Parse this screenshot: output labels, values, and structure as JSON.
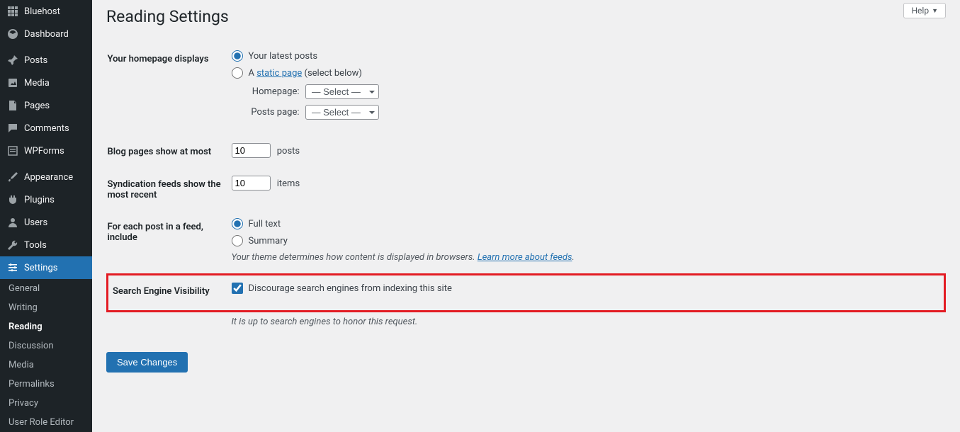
{
  "sidebar": {
    "top": [
      {
        "icon": "grid",
        "label": "Bluehost"
      },
      {
        "icon": "dashboard",
        "label": "Dashboard"
      }
    ],
    "content": [
      {
        "icon": "pin",
        "label": "Posts"
      },
      {
        "icon": "media",
        "label": "Media"
      },
      {
        "icon": "page",
        "label": "Pages"
      },
      {
        "icon": "comment",
        "label": "Comments"
      },
      {
        "icon": "form",
        "label": "WPForms"
      }
    ],
    "config": [
      {
        "icon": "brush",
        "label": "Appearance"
      },
      {
        "icon": "plug",
        "label": "Plugins"
      },
      {
        "icon": "user",
        "label": "Users"
      },
      {
        "icon": "wrench",
        "label": "Tools"
      },
      {
        "icon": "sliders",
        "label": "Settings",
        "active": true
      }
    ],
    "subs": [
      {
        "label": "General"
      },
      {
        "label": "Writing"
      },
      {
        "label": "Reading",
        "current": true
      },
      {
        "label": "Discussion"
      },
      {
        "label": "Media"
      },
      {
        "label": "Permalinks"
      },
      {
        "label": "Privacy"
      },
      {
        "label": "User Role Editor"
      }
    ]
  },
  "help": "Help",
  "page_title": "Reading Settings",
  "homepage": {
    "label": "Your homepage displays",
    "opt_latest": "Your latest posts",
    "opt_static_prefix": "A ",
    "opt_static_link": "static page",
    "opt_static_suffix": " (select below)",
    "homepage_label": "Homepage:",
    "postspage_label": "Posts page:",
    "select_placeholder": "— Select —"
  },
  "blog_pages": {
    "label": "Blog pages show at most",
    "value": "10",
    "suffix": "posts"
  },
  "syndication": {
    "label": "Syndication feeds show the most recent",
    "value": "10",
    "suffix": "items"
  },
  "feed_include": {
    "label": "For each post in a feed, include",
    "opt_full": "Full text",
    "opt_summary": "Summary",
    "desc_prefix": "Your theme determines how content is displayed in browsers. ",
    "desc_link": "Learn more about feeds",
    "desc_suffix": "."
  },
  "search_vis": {
    "label": "Search Engine Visibility",
    "checkbox": "Discourage search engines from indexing this site",
    "desc": "It is up to search engines to honor this request."
  },
  "save": "Save Changes"
}
